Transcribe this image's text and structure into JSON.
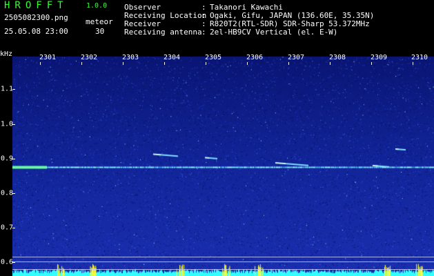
{
  "header": {
    "app_name": "HROFFT",
    "app_version": "1.0.0",
    "file_name": "2505082300.png",
    "datetime": "25.05.08 23:00",
    "meteor_label": "meteor",
    "meteor_count": "30"
  },
  "info": [
    {
      "key": "Observer",
      "value": "Takanori Kawachi"
    },
    {
      "key": "Receiving Location",
      "value": "Ogaki, Gifu, JAPAN (136.60E, 35.35N)"
    },
    {
      "key": "Receiver",
      "value": "R820T2(RTL-SDR) SDR-Sharp 53.372MHz"
    },
    {
      "key": "Receiving antenna",
      "value": "2el-HB9CV Vertical (el. E-W)"
    }
  ],
  "colon": ":",
  "axis": {
    "y_unit": "kHz",
    "y_ticks": [
      "1.1",
      "1.0",
      "0.9",
      "0.8",
      "0.7",
      "0.6"
    ],
    "x_ticks": [
      "2301",
      "2302",
      "2303",
      "2304",
      "2305",
      "2306",
      "2307",
      "2308",
      "2309",
      "2310"
    ]
  },
  "colors": {
    "header_green": "#33ff33",
    "background": "#000000",
    "spectrogram_base": "#0e1c8a",
    "carrier_line": "#66ddff",
    "noise_strip": "#33ffff",
    "burst_yellow": "#ffff33"
  },
  "signals": {
    "carrier_khz": 0.877,
    "meteor_echoes": [
      {
        "minute": 3.55,
        "khz": 0.915,
        "duration_min": 0.6
      },
      {
        "minute": 4.8,
        "khz": 0.905,
        "duration_min": 0.3
      },
      {
        "minute": 6.5,
        "khz": 0.89,
        "duration_min": 0.8
      },
      {
        "minute": 8.85,
        "khz": 0.882,
        "duration_min": 0.4
      },
      {
        "minute": 9.4,
        "khz": 0.93,
        "duration_min": 0.25
      }
    ]
  }
}
